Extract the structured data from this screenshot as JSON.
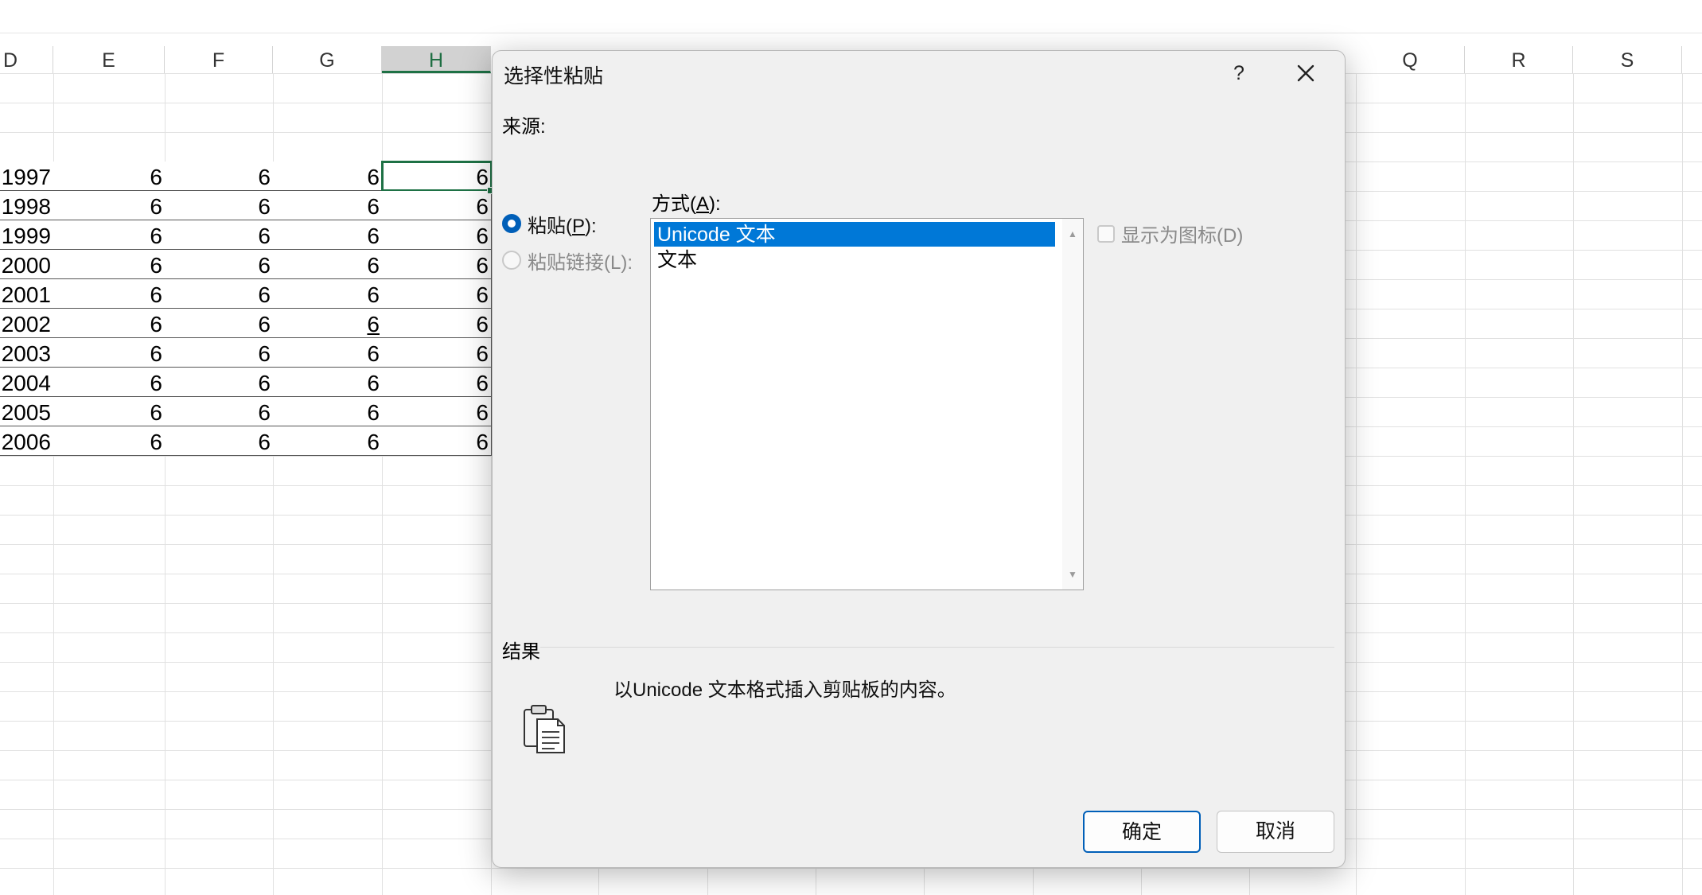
{
  "sheet": {
    "columns": [
      {
        "label": "D",
        "active": false
      },
      {
        "label": "E",
        "active": false
      },
      {
        "label": "F",
        "active": false
      },
      {
        "label": "G",
        "active": false
      },
      {
        "label": "H",
        "active": true
      },
      {
        "label": "Q",
        "active": false
      },
      {
        "label": "R",
        "active": false
      },
      {
        "label": "S",
        "active": false
      }
    ],
    "rows": [
      [
        "1997",
        "6",
        "6",
        "6",
        "6"
      ],
      [
        "1998",
        "6",
        "6",
        "6",
        "6"
      ],
      [
        "1999",
        "6",
        "6",
        "6",
        "6"
      ],
      [
        "2000",
        "6",
        "6",
        "6",
        "6"
      ],
      [
        "2001",
        "6",
        "6",
        "6",
        "6"
      ],
      [
        "2002",
        "6",
        "6",
        "6",
        "6"
      ],
      [
        "2003",
        "6",
        "6",
        "6",
        "6"
      ],
      [
        "2004",
        "6",
        "6",
        "6",
        "6"
      ],
      [
        "2005",
        "6",
        "6",
        "6",
        "6"
      ],
      [
        "2006",
        "6",
        "6",
        "6",
        "6"
      ]
    ],
    "selected_cell": {
      "row": 0,
      "col": 4
    },
    "underlined_cell": {
      "row": 5,
      "col": 3
    },
    "accent_color": "#1e7145"
  },
  "dialog": {
    "title": "选择性粘贴",
    "help_label": "?",
    "source_label": "来源:",
    "method_label_pre": "方式(",
    "method_label_key": "A",
    "method_label_post": "):",
    "paste_option": {
      "pre": "粘贴(",
      "key": "P",
      "post": "):",
      "checked": true
    },
    "paste_link_option": {
      "label": "粘贴链接(L):",
      "checked": false,
      "disabled": true
    },
    "formats": [
      {
        "label": "Unicode 文本",
        "selected": true
      },
      {
        "label": "文本",
        "selected": false
      }
    ],
    "display_as_icon": {
      "label": "显示为图标(D)",
      "checked": false,
      "disabled": true
    },
    "result_label": "结果",
    "result_text": "以Unicode 文本格式插入剪贴板的内容。",
    "ok_label": "确定",
    "cancel_label": "取消",
    "select_color": "#0078d7",
    "primary_color": "#005fb8"
  }
}
